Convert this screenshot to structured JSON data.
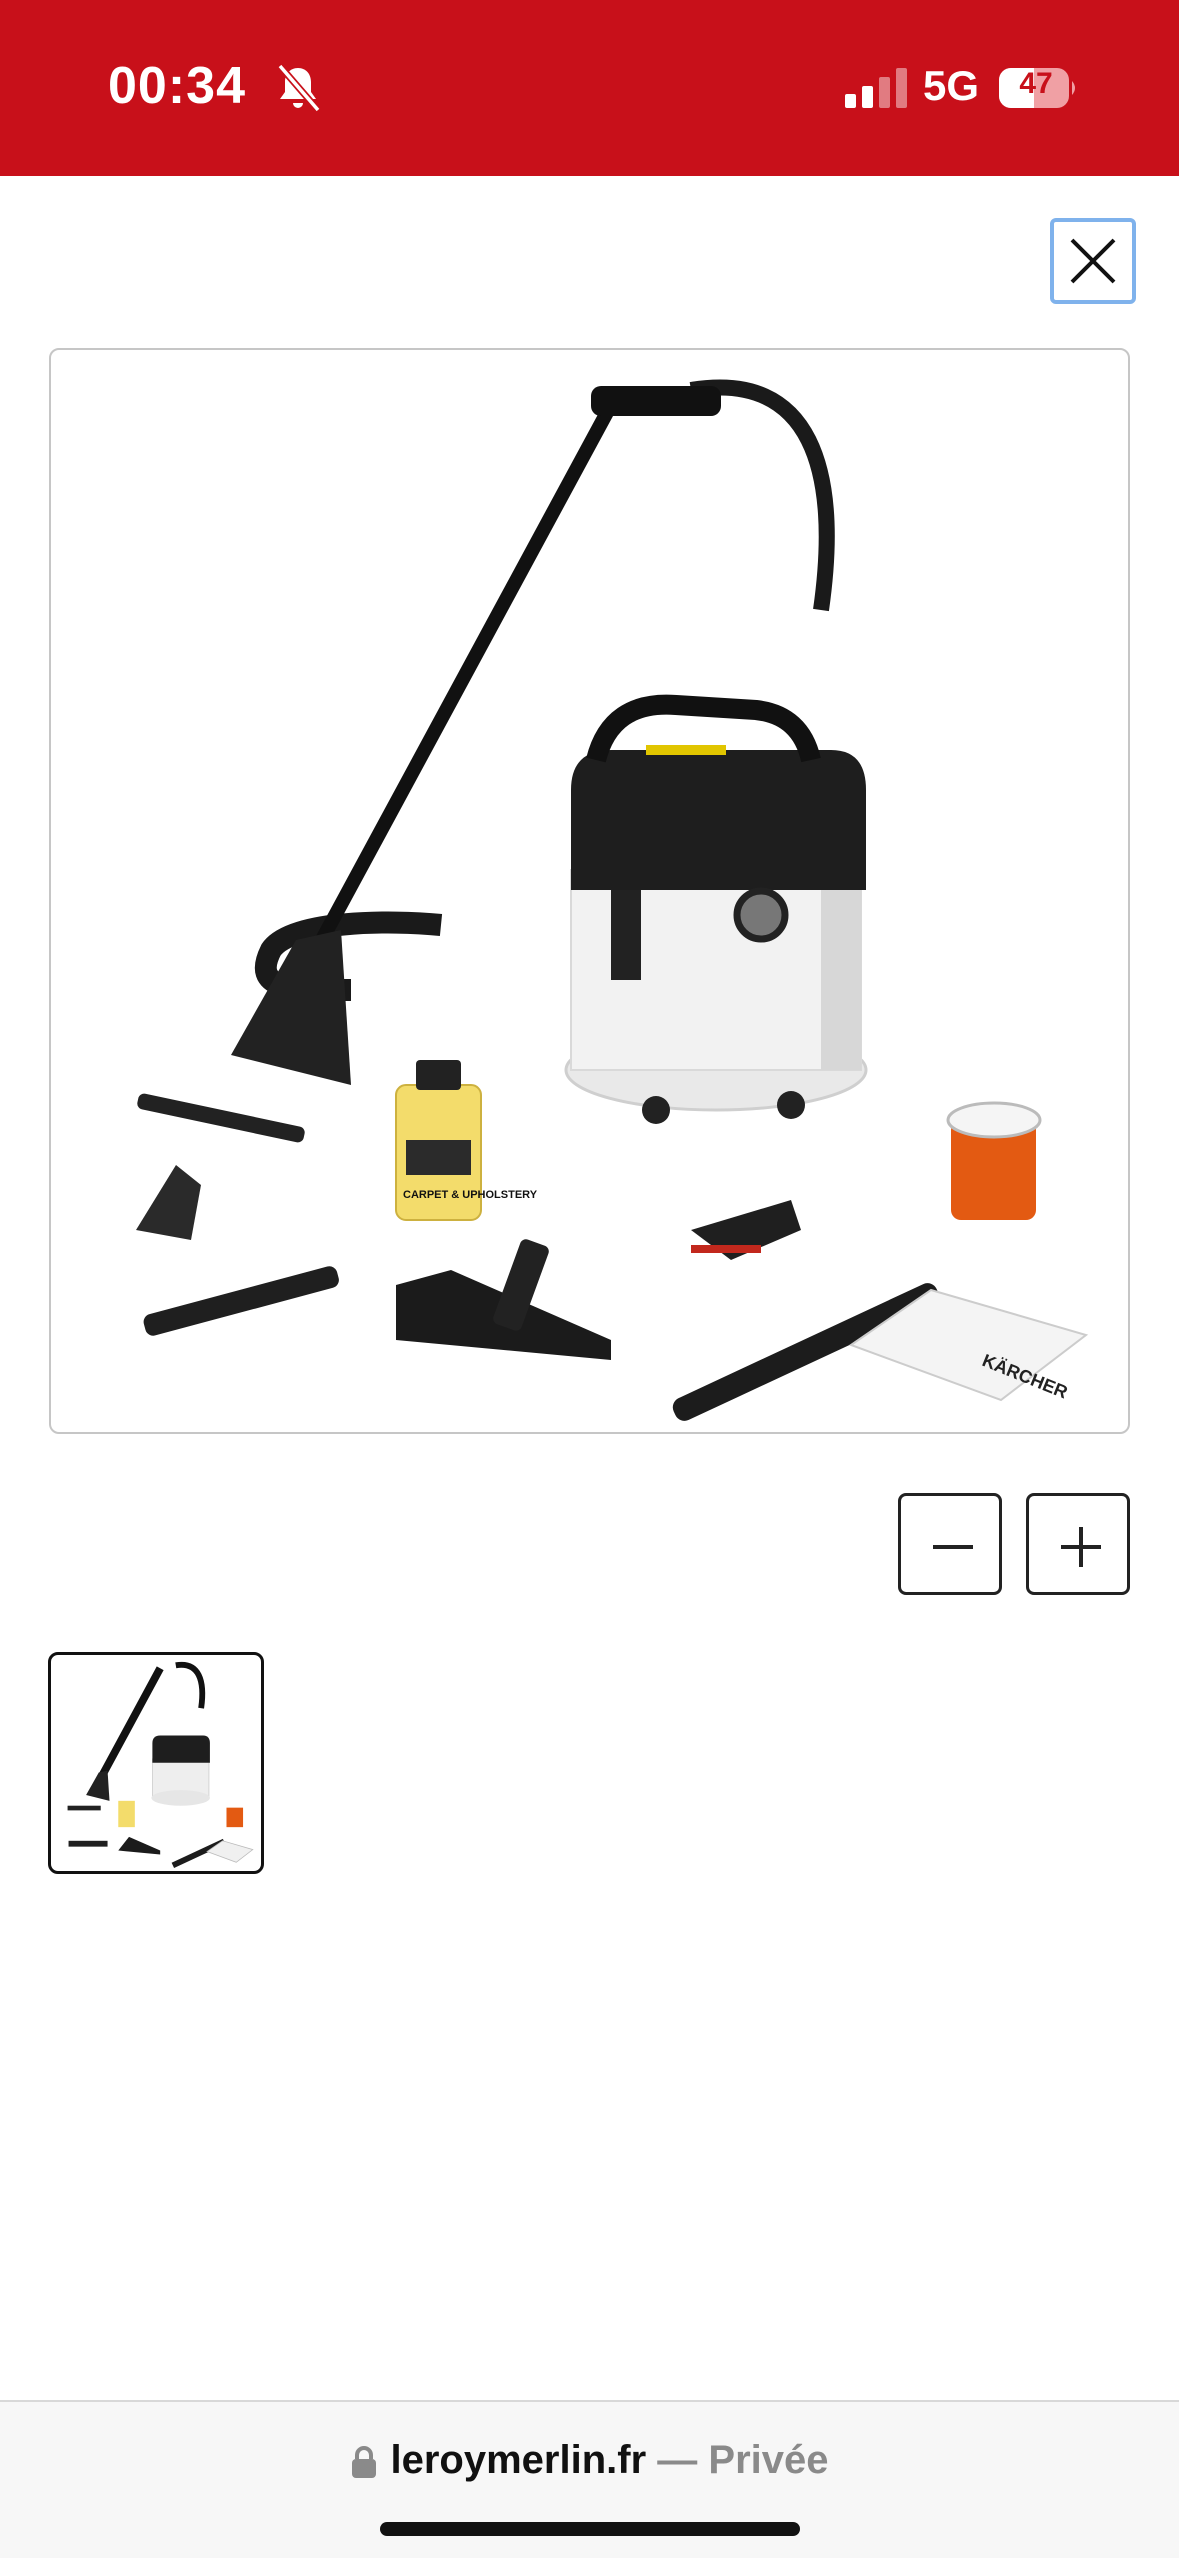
{
  "status_bar": {
    "time": "00:34",
    "network": "5G",
    "battery": "47",
    "icons": [
      "bell-slash-icon",
      "cellular-signal-icon",
      "battery-icon"
    ]
  },
  "viewer": {
    "close_icon": "close-icon",
    "zoom_out_icon": "minus-icon",
    "zoom_in_icon": "plus-icon",
    "product_label": "CARPET & UPHOLSTERY",
    "brand": "KÄRCHER"
  },
  "browser": {
    "domain": "leroymerlin.fr",
    "mode": "— Privée",
    "lock_icon": "lock-icon"
  },
  "colors": {
    "status_red": "#c8101a",
    "focus_blue": "#7fb2ec"
  }
}
